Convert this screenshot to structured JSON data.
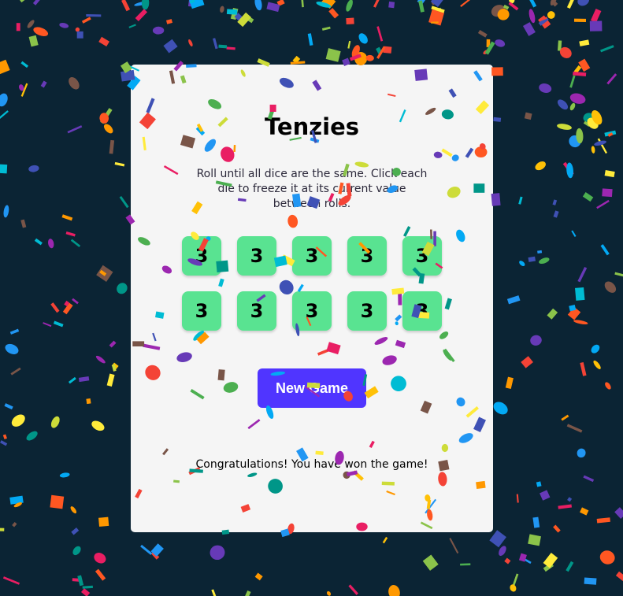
{
  "game": {
    "title": "Tenzies",
    "instructions": "Roll until all dice are the same. Click each die to freeze it at its current value between rolls.",
    "dice": [
      "3",
      "3",
      "3",
      "3",
      "3",
      "3",
      "3",
      "3",
      "3",
      "3"
    ],
    "new_game_label": "New Game",
    "status_message": "Congratulations! You have won the game!"
  },
  "colors": {
    "background": "#0b2434",
    "board": "#f5f5f5",
    "die_held": "#59e391",
    "button": "#5035ff"
  },
  "confetti_colors": [
    "#f44336",
    "#e91e63",
    "#9c27b0",
    "#673ab7",
    "#3f51b5",
    "#2196f3",
    "#03a9f4",
    "#00bcd4",
    "#009688",
    "#4caf50",
    "#8bc34a",
    "#cddc39",
    "#ffeb3b",
    "#ffc107",
    "#ff9800",
    "#ff5722",
    "#795548"
  ]
}
